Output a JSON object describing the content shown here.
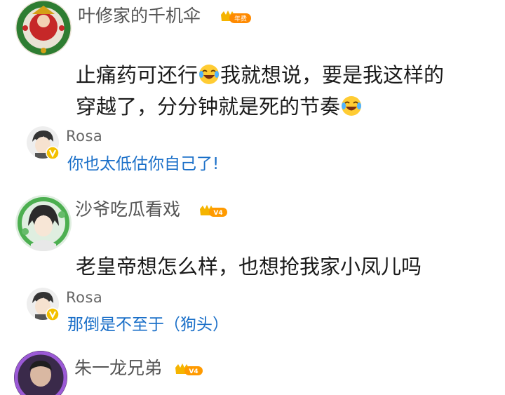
{
  "comments": [
    {
      "username": "叶修家的千机伞",
      "badge": "年费",
      "text_line1_a": "止痛药可还行",
      "text_line1_b": "我就想说，要是我这样的",
      "text_line2_a": "穿越了，分分钟就是死的节奏",
      "reply": {
        "username": "Rosa",
        "text": "你也太低估你自己了!"
      }
    },
    {
      "username": "沙爷吃瓜看戏",
      "badge": "V4",
      "text": "老皇帝想怎么样，也想抢我家小凤儿吗",
      "reply": {
        "username": "Rosa",
        "text": "那倒是不至于（狗头）"
      }
    },
    {
      "username": "朱一龙兄弟",
      "badge": "V4"
    }
  ],
  "icons": {
    "emoji": "laugh-cry-emoji-icon",
    "crown": "crown-icon",
    "verified": "verified-v-icon"
  },
  "colors": {
    "reply_text": "#1a6fc8",
    "badge_gold": "#f5b400",
    "verified_yellow": "#f3c000"
  }
}
